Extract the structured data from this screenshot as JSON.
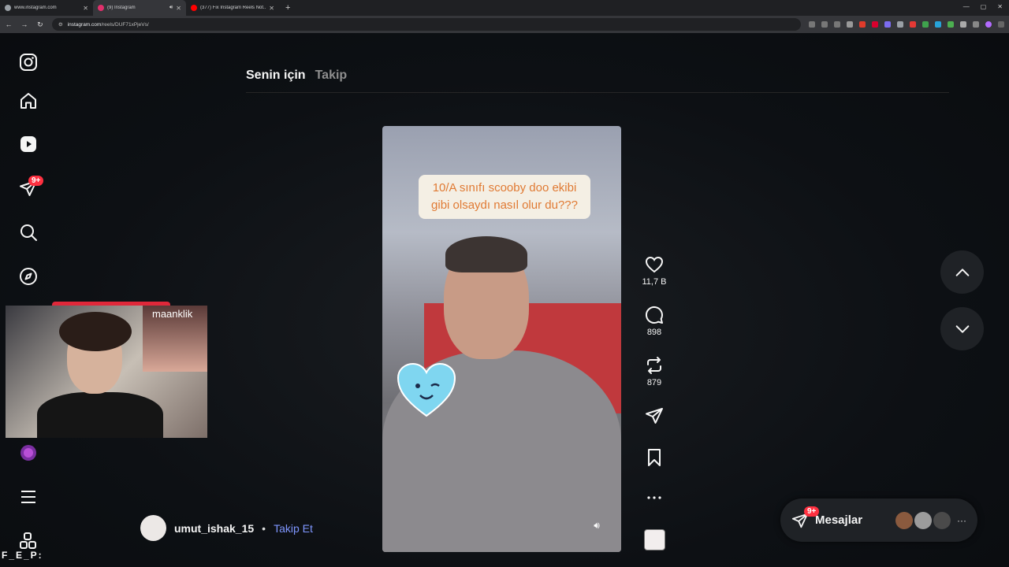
{
  "browser": {
    "tabs": [
      {
        "title": "www.instagram.com",
        "favicon_color": "#9aa0a6"
      },
      {
        "title": "(9) Instagram",
        "favicon_color": "#e1306c"
      },
      {
        "title": "(377) Fix Instagram Reels Not...",
        "favicon_color": "#ff0000"
      }
    ],
    "new_tab": "+",
    "url_host": "instagram.com",
    "url_path": "/reels/DUF71xPjeVs/"
  },
  "sidebar": {
    "badge": "9+",
    "icons": [
      "instagram-logo-icon",
      "home-icon",
      "reels-icon",
      "messages-icon",
      "search-icon",
      "explore-icon",
      "profile-icon",
      "menu-icon",
      "more-icon"
    ]
  },
  "feed_tabs": {
    "active": "Senin için",
    "inactive": "Takip"
  },
  "reel": {
    "caption": "10/A sınıfı scooby doo ekibi gibi olsaydı nasıl olur du???",
    "likes": "11,7 B",
    "comments": "898",
    "reposts": "879",
    "author": "umut_ishak_15",
    "separator": "•",
    "follow": "Takip Et"
  },
  "messages": {
    "label": "Mesajlar",
    "badge": "9+",
    "more": "···"
  },
  "overlay": {
    "pip_tag": "maanklik",
    "bottom_text": "F_E_P:"
  },
  "colors": {
    "accent": "#ff3040",
    "link": "#7f96ff",
    "background": "#0c0f13"
  }
}
